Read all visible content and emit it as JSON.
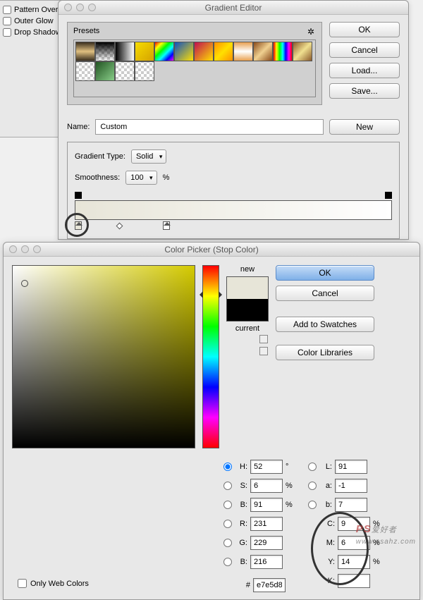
{
  "layer_panel": {
    "pattern_overlay": "Pattern Over",
    "outer_glow": "Outer Glow",
    "drop_shadow": "Drop Shadow"
  },
  "gradient_editor": {
    "title": "Gradient Editor",
    "presets_label": "Presets",
    "ok": "OK",
    "cancel": "Cancel",
    "load": "Load...",
    "save": "Save...",
    "name_label": "Name:",
    "name_value": "Custom",
    "new_btn": "New",
    "type_label": "Gradient Type:",
    "type_value": "Solid",
    "smoothness_label": "Smoothness:",
    "smoothness_value": "100",
    "percent": "%"
  },
  "color_picker": {
    "title": "Color Picker (Stop Color)",
    "ok": "OK",
    "cancel": "Cancel",
    "add_swatches": "Add to Swatches",
    "color_libraries": "Color Libraries",
    "new_label": "new",
    "current_label": "current",
    "only_web": "Only Web Colors",
    "H_label": "H:",
    "H_val": "52",
    "deg": "°",
    "S_label": "S:",
    "S_val": "6",
    "Bh_label": "B:",
    "Bh_val": "91",
    "R_label": "R:",
    "R_val": "231",
    "G_label": "G:",
    "G_val": "229",
    "Bl_label": "B:",
    "Bl_val": "216",
    "L_label": "L:",
    "L_val": "91",
    "a_label": "a:",
    "a_val": "-1",
    "b_label": "b:",
    "b_val": "7",
    "C_label": "C:",
    "C_val": "9",
    "M_label": "M:",
    "M_val": "6",
    "Y_label": "Y:",
    "Y_val": "14",
    "K_label": "K:",
    "K_val": "",
    "hash": "#",
    "hex": "e7e5d8",
    "pct": "%"
  },
  "watermark": {
    "ps": "PS",
    "rest": "爱好者",
    "url": "www.psahz.com"
  }
}
